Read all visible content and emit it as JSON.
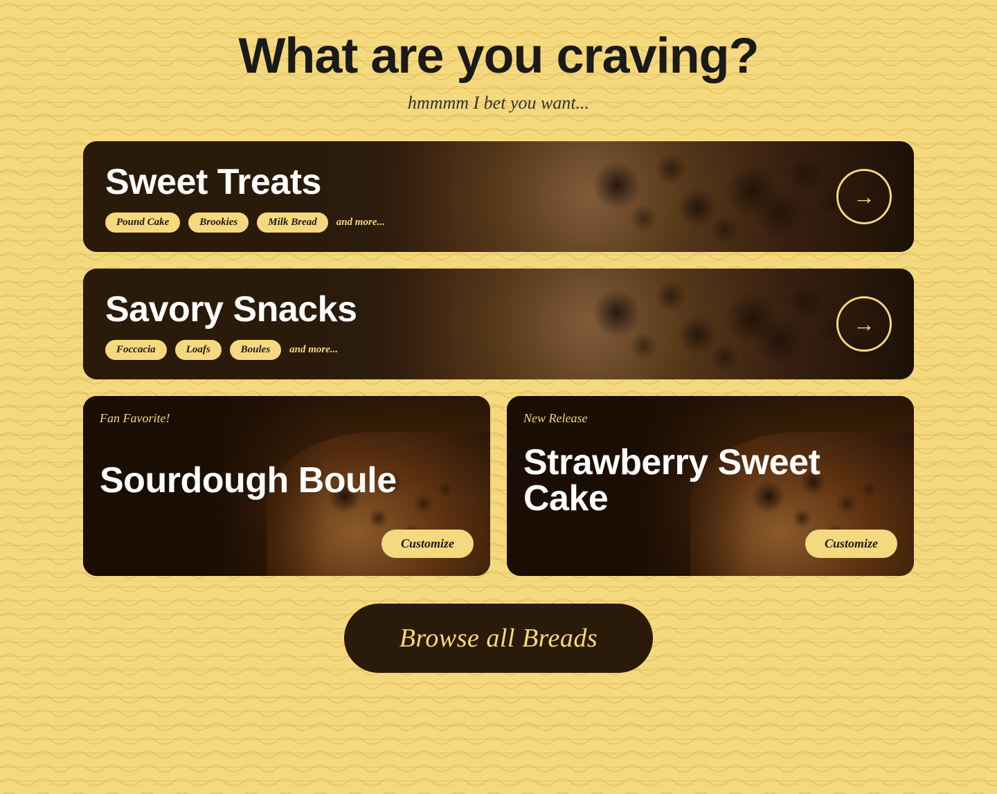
{
  "page": {
    "title": "What are you craving?",
    "subtitle": "hmmmm I bet you want...",
    "background_color": "#f5d97e"
  },
  "categories": [
    {
      "id": "sweet-treats",
      "title": "Sweet Treats",
      "tags": [
        "Pound Cake",
        "Brookies",
        "Milk Bread"
      ],
      "tag_more": "and more...",
      "arrow_label": "→"
    },
    {
      "id": "savory-snacks",
      "title": "Savory Snacks",
      "tags": [
        "Foccacia",
        "Loafs",
        "Boules"
      ],
      "tag_more": "and more...",
      "arrow_label": "→"
    }
  ],
  "featured": [
    {
      "id": "sourdough-boule",
      "badge": "Fan Favorite!",
      "title": "Sourdough Boule",
      "customize_label": "Customize"
    },
    {
      "id": "strawberry-sweet-cake",
      "badge": "New Release",
      "title": "Strawberry Sweet Cake",
      "customize_label": "Customize"
    }
  ],
  "browse_button": {
    "label": "Browse all Breads"
  }
}
